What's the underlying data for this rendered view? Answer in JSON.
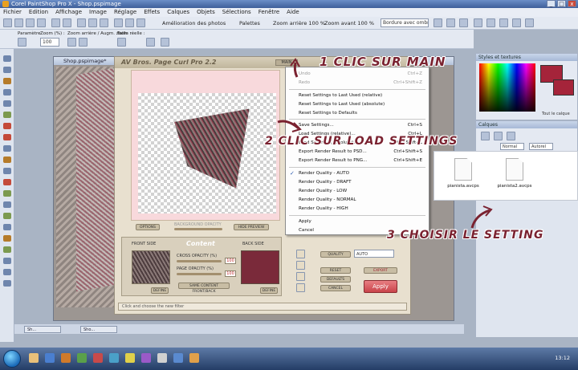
{
  "window": {
    "title": "Corel PaintShop Pro X - Shop.pspimage",
    "buttons": [
      "_",
      "□",
      "x"
    ]
  },
  "menubar": [
    "Fichier",
    "Edition",
    "Affichage",
    "Image",
    "Réglage",
    "Effets",
    "Calques",
    "Objets",
    "Sélections",
    "Fenêtre",
    "Aide"
  ],
  "toolbar": {
    "enhance_label": "Amélioration des photos",
    "palettes_label": "Palettes",
    "zoom_out_label": "Zoom arrière 100 %",
    "zoom_in_label": "Zoom avant 100 %",
    "border_dropdown": "Bordure avec ombre ...",
    "preset_label": "Paramètre",
    "zoom_label": "Zoom (%) :",
    "zoom_value": "100",
    "zoom_step_label": "Zoom arrière / Augm. zoom :",
    "size_label": "Taille réelle :"
  },
  "document": {
    "title": "Shop.pspimage*"
  },
  "plugin": {
    "title": "AV Bros. Page Curl Pro 2.2",
    "main_button": "MAIN",
    "options_button": "OPTIONS",
    "hide_preview": "HIDE PREVIEW",
    "background_opacity": "BACKGROUND OPACITY",
    "content_title": "Content",
    "front_side": "FRONT SIDE",
    "back_side": "BACK SIDE",
    "cross_opacity": "CROSS OPACITY (%)",
    "page_opacity": "PAGE OPACITY (%)",
    "cross_value": "100",
    "page_value": "100",
    "define_front": "DEFINE",
    "define_back": "DEFINE",
    "same_content": "SAME CONTENT FRONT/BACK",
    "quality_label": "QUALITY",
    "quality_value": "AUTO",
    "reset": "RESET",
    "defaults": "DEFAULTS",
    "export": "EXPORT",
    "cancel": "CANCEL",
    "apply": "Apply",
    "status": "Click and choose the new filter"
  },
  "context_menu": {
    "items": [
      {
        "label": "Undo",
        "shortcut": "Ctrl+Z",
        "disabled": true
      },
      {
        "label": "Redo",
        "shortcut": "Ctrl+Shift+Z",
        "disabled": true
      },
      {
        "label": "Reset Settings to Last Used (relative)",
        "shortcut": ""
      },
      {
        "label": "Reset Settings to Last Used (absolute)",
        "shortcut": ""
      },
      {
        "label": "Reset Settings to Defaults",
        "shortcut": ""
      },
      {
        "label": "Save Settings...",
        "shortcut": "Ctrl+S"
      },
      {
        "label": "Load Settings (relative)...",
        "shortcut": "Ctrl+L"
      },
      {
        "label": "Load Settings (absolute)...",
        "shortcut": "Ctrl+Shift+L"
      },
      {
        "label": "Export Render Result to PSD...",
        "shortcut": "Ctrl+Shift+S"
      },
      {
        "label": "Export Render Result to PNG...",
        "shortcut": "Ctrl+Shift+E"
      },
      {
        "label": "Render Quality - AUTO",
        "shortcut": "",
        "checked": true
      },
      {
        "label": "Render Quality - DRAFT",
        "shortcut": ""
      },
      {
        "label": "Render Quality - LOW",
        "shortcut": ""
      },
      {
        "label": "Render Quality - NORMAL",
        "shortcut": ""
      },
      {
        "label": "Render Quality - HIGH",
        "shortcut": ""
      },
      {
        "label": "Apply",
        "shortcut": ""
      },
      {
        "label": "Cancel",
        "shortcut": ""
      }
    ]
  },
  "panels": {
    "styles_title": "Styles et textures",
    "layers_title": "Calques",
    "transparent_label": "Tout le calque",
    "blend_mode": "Normal",
    "auto_label": "Autorel"
  },
  "files": [
    {
      "name": "pianista.avcps"
    },
    {
      "name": "pianista2.avcps"
    }
  ],
  "annotations": {
    "step1": "1 CLIC SUR MAIN",
    "step2": "2 CLIC SUR LOAD SETTINGS",
    "step3": "3 CHOISIR LE SETTING"
  },
  "doc_tabs": [
    "Sh...",
    "Sho..."
  ],
  "clock": "13:12",
  "colors": {
    "accent": "#a5243a",
    "annotation": "#7a2230",
    "apply_button": "#c9444a"
  }
}
